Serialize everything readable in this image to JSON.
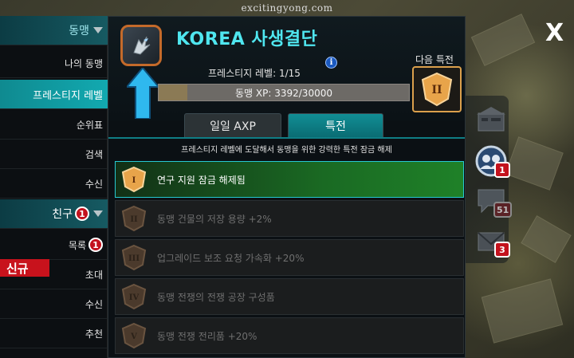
{
  "watermark": "excitingyong.com",
  "sidebar": {
    "alliance_header": "동맹",
    "items": [
      {
        "label": "나의 동맹"
      },
      {
        "label": "프레스티지 레벨"
      },
      {
        "label": "순위표"
      },
      {
        "label": "검색"
      },
      {
        "label": "수신"
      }
    ],
    "friends_header": "친구",
    "friends_badge": "1",
    "friend_items": [
      {
        "label": "목록",
        "badge": "1"
      },
      {
        "label": "초대"
      },
      {
        "label": "수신"
      },
      {
        "label": "추천"
      }
    ],
    "new_tag": "신규"
  },
  "header": {
    "title": "KOREA 사생결단",
    "prestige_label": "프레스티지 레벨: 1/15",
    "info_icon": "i",
    "xp_text": "동맹 XP: 3392/30000",
    "xp_current": 3392,
    "xp_max": 30000,
    "next_perk_label": "다음 특전",
    "next_perk_numeral": "II"
  },
  "tabs": [
    {
      "label": "일일 AXP"
    },
    {
      "label": "특전"
    }
  ],
  "description": "프레스티지 레벨에 도달해서 동맹을 위한 강력한 특전 잠금 해제",
  "perks": [
    {
      "numeral": "I",
      "label": "연구 지원 잠금 해제됨",
      "unlocked": true
    },
    {
      "numeral": "II",
      "label": "동맹 건물의 저장 용량 +2%",
      "unlocked": false
    },
    {
      "numeral": "III",
      "label": "업그레이드 보조 요청 가속화 +20%",
      "unlocked": false
    },
    {
      "numeral": "IV",
      "label": "동맹 전쟁의 전쟁 공장 구성품",
      "unlocked": false
    },
    {
      "numeral": "V",
      "label": "동맹 전쟁 전리품 +20%",
      "unlocked": false
    }
  ],
  "right_panel": {
    "close_label": "X",
    "alliance_badge": "1",
    "chat_badge": "51",
    "mail_badge": "3"
  },
  "colors": {
    "accent": "#4fe6ef",
    "active_tab": "#118e95",
    "badge_red": "#c3121d",
    "emblem_border": "#c46a2a"
  }
}
